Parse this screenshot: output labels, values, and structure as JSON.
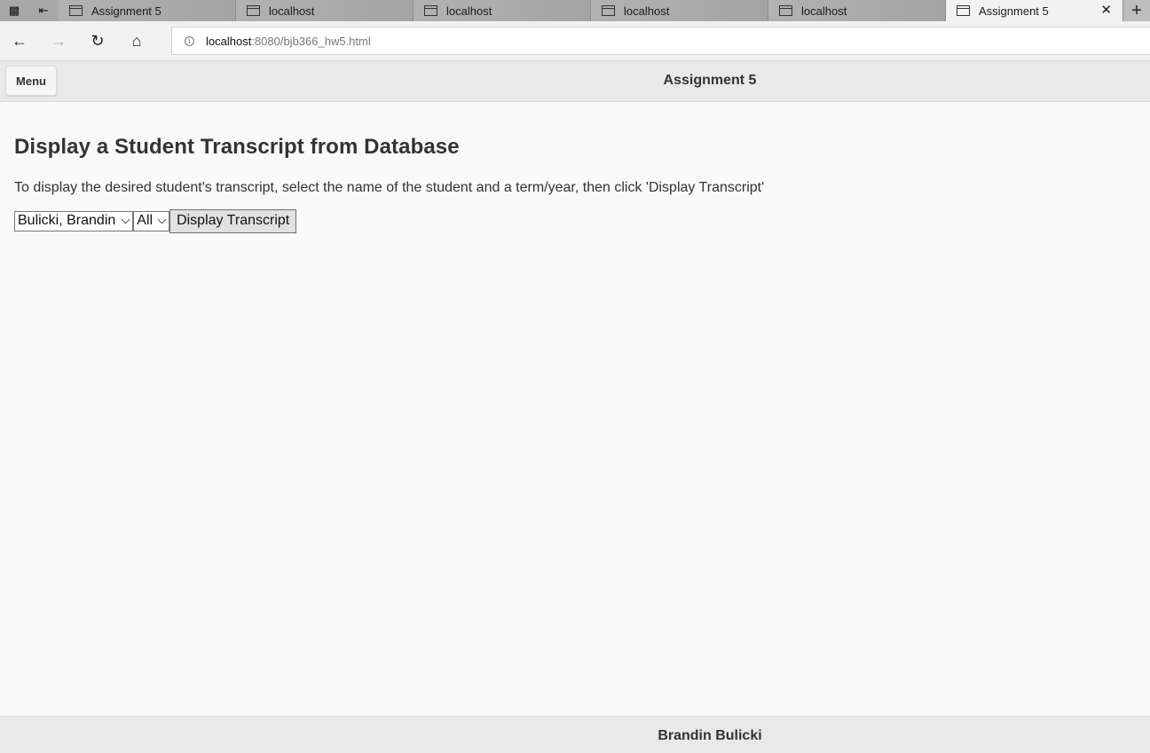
{
  "browser": {
    "tabs": [
      {
        "title": "Assignment 5",
        "active": false
      },
      {
        "title": "localhost",
        "active": false
      },
      {
        "title": "localhost",
        "active": false
      },
      {
        "title": "localhost",
        "active": false
      },
      {
        "title": "localhost",
        "active": false
      },
      {
        "title": "Assignment 5",
        "active": true
      }
    ],
    "url_host": "localhost",
    "url_rest": ":8080/bjb366_hw5.html"
  },
  "header": {
    "menu_label": "Menu",
    "title": "Assignment 5"
  },
  "main": {
    "heading": "Display a Student Transcript from Database",
    "instructions": "To display the desired student's transcript, select the name of the student and a term/year, then click 'Display Transcript'",
    "student_select_value": "Bulicki, Brandin",
    "term_select_value": "All",
    "display_button_label": "Display Transcript"
  },
  "footer": {
    "text": "Brandin Bulicki"
  }
}
